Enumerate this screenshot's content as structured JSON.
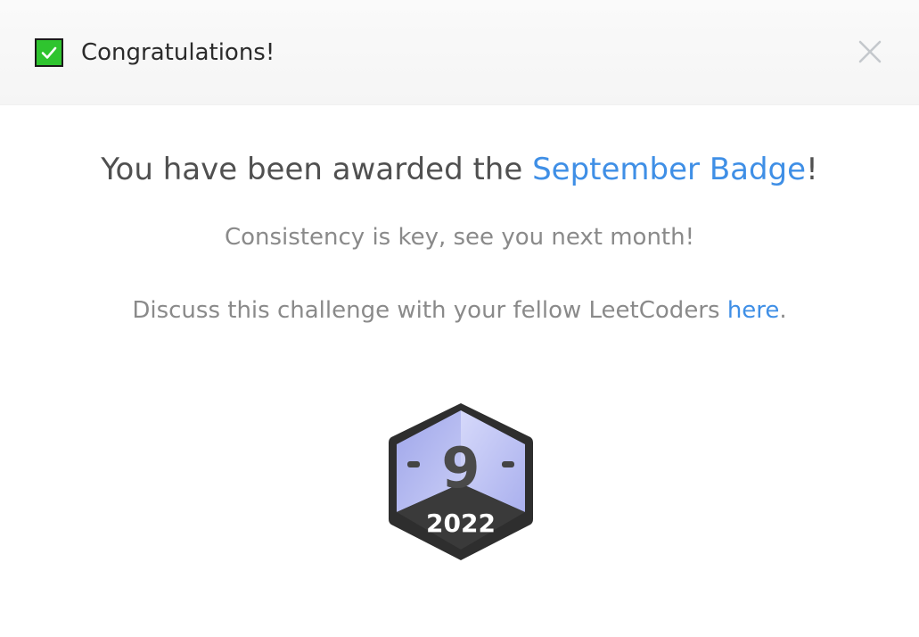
{
  "header": {
    "title": "Congratulations!",
    "check_icon": "check-icon",
    "close_icon": "close-icon"
  },
  "body": {
    "headline_prefix": "You have been awarded the ",
    "headline_link": "September Badge",
    "headline_suffix": "!",
    "subtext": "Consistency is key, see you next month!",
    "discuss_prefix": "Discuss this challenge with your fellow LeetCoders ",
    "discuss_link": "here",
    "discuss_suffix": "."
  },
  "badge": {
    "month_number": "9",
    "year": "2022"
  },
  "colors": {
    "link": "#3f8fe6",
    "check": "#2fc42f",
    "badge_face": "#b7bdf3",
    "badge_dark": "#2e2e2e"
  }
}
